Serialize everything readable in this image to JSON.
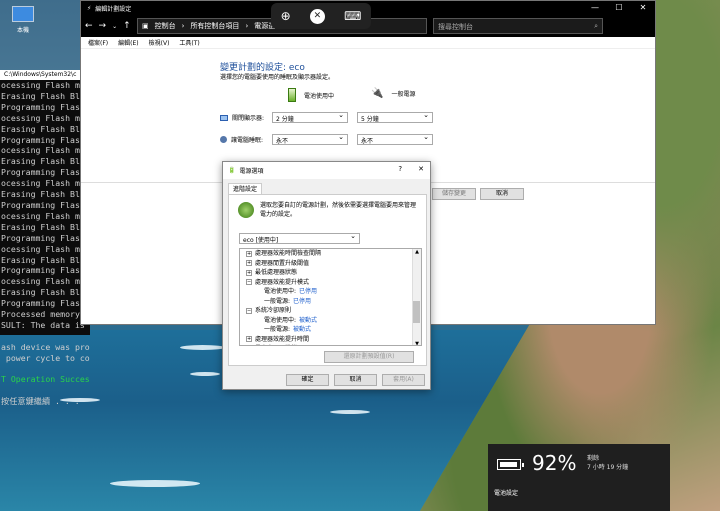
{
  "desktop": {
    "icon_label": "本機"
  },
  "console": {
    "title": "C:\\Windows\\System32\\c",
    "lines": [
      "ocessing Flash memo",
      "Erasing Flash Block",
      "Programming Flash [",
      "ocessing Flash memo",
      "Erasing Flash Block",
      "Programming Flash [",
      "ocessing Flash memo",
      "Erasing Flash Block",
      "Programming Flash [",
      "ocessing Flash memo",
      "Erasing Flash Block",
      "Programming Flash [",
      "ocessing Flash memo",
      "Erasing Flash Block",
      "Programming Flash [",
      "ocessing Flash memo",
      "Erasing Flash Block",
      "Programming Flash [",
      "ocessing Flash memo",
      "Erasing Flash Block",
      "Programming Flash [",
      "Processed memory bl",
      "SULT: The data is i",
      "",
      "ash device was prog",
      " power cycle to com",
      "",
      "T Operation Success",
      "",
      "按任意鍵繼續 . . ."
    ]
  },
  "control_panel": {
    "window_title": "編輯計劃設定",
    "address": [
      "控制台",
      "所有控制台項目",
      "電源選項"
    ],
    "search_placeholder": "搜尋控制台",
    "menu": [
      "檔案(F)",
      "編輯(E)",
      "檢視(V)",
      "工具(T)"
    ],
    "heading": "變更計劃的設定: eco",
    "subtitle": "選擇您的電腦要使用的睡眠及顯示器設定。",
    "col_battery": "電池使用中",
    "col_plugged": "一般電源",
    "row_display": "關閉顯示器:",
    "row_sleep": "讓電腦睡眠:",
    "display_battery": "2 分鐘",
    "display_plugged": "5 分鐘",
    "sleep_battery": "永不",
    "sleep_plugged": "永不",
    "save_button": "儲存變更",
    "cancel_button": "取消"
  },
  "dialog": {
    "title": "電源選項",
    "help": "?",
    "tab": "進階設定",
    "intro": "選取您要自訂的電源計劃，然後依需要選擇電腦要用來管理電力的設定。",
    "plan_value": "eco [使用中]",
    "tree": [
      {
        "text": "處理器效能時間檢查間隔",
        "indent": 0,
        "exp": "+"
      },
      {
        "text": "處理器閒置升級閾值",
        "indent": 0,
        "exp": "+"
      },
      {
        "text": "最低處理器狀態",
        "indent": 0,
        "exp": "+"
      },
      {
        "text": "處理器效能提升模式",
        "indent": 0,
        "exp": "−"
      },
      {
        "text": "電池使用中:",
        "value": "已停用",
        "indent": 1
      },
      {
        "text": "一般電源:",
        "value": "已停用",
        "indent": 1
      },
      {
        "text": "系統冷卻原則",
        "indent": 0,
        "exp": "−"
      },
      {
        "text": "電池使用中:",
        "value": "被動式",
        "indent": 1
      },
      {
        "text": "一般電源:",
        "value": "被動式",
        "indent": 1
      },
      {
        "text": "處理器效能提升時間",
        "indent": 0,
        "exp": "+"
      },
      {
        "text": "最高處理器狀態",
        "indent": 0,
        "exp": "+"
      }
    ],
    "restore_button": "還原計劃預設值(R)",
    "ok_button": "確定",
    "cancel_button": "取消",
    "apply_button": "套用(A)"
  },
  "battery": {
    "percent": "92%",
    "remaining_label": "剩餘",
    "remaining_time": "7 小時 19 分鐘",
    "settings_link": "電池設定",
    "level": 0.92
  }
}
